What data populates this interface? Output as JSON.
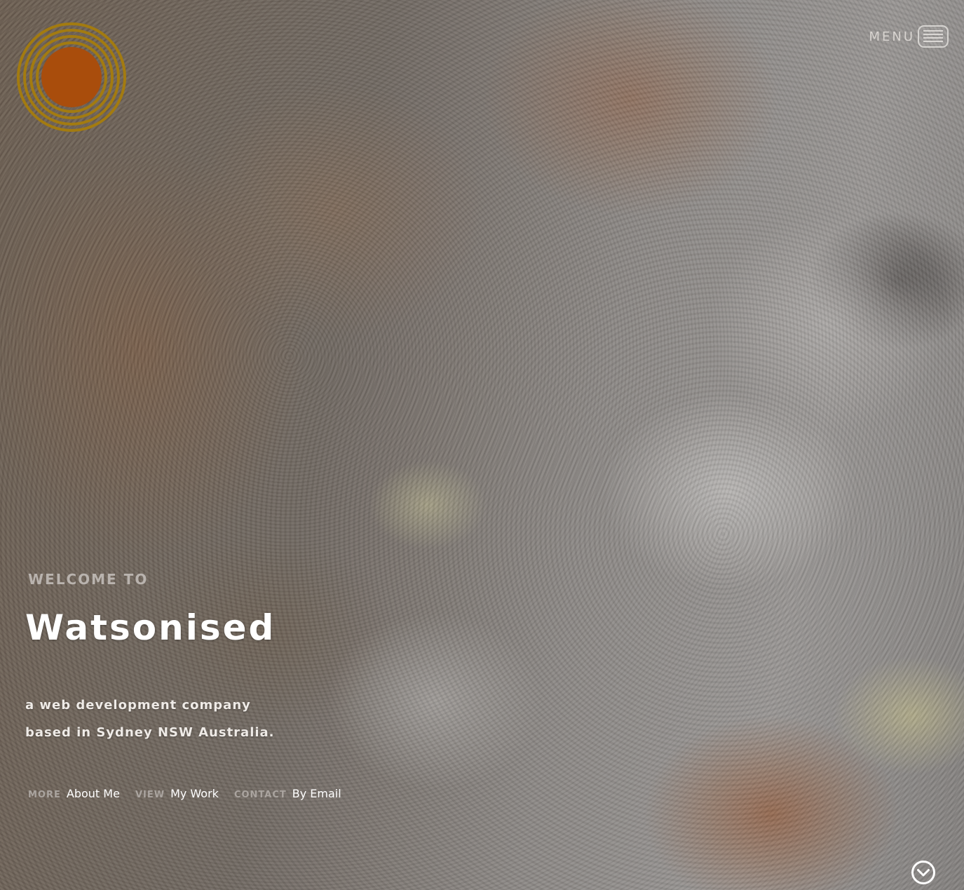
{
  "brand": {
    "logo_icon": "concentric-sun-logo-icon",
    "ring_color": "#a37b10",
    "core_color": "#a94d0c"
  },
  "header": {
    "menu_label": "MENU",
    "menu_icon": "hamburger-icon"
  },
  "hero": {
    "eyebrow": "WELCOME TO",
    "title": "Watsonised",
    "tagline_line1": "a web development company",
    "tagline_line2": "based in Sydney NSW Australia."
  },
  "links": [
    {
      "prefix": "MORE",
      "label": "About Me"
    },
    {
      "prefix": "VIEW",
      "label": "My Work"
    },
    {
      "prefix": "CONTACT",
      "label": "By Email"
    }
  ],
  "scroll": {
    "icon": "chevron-down-circle-icon"
  }
}
